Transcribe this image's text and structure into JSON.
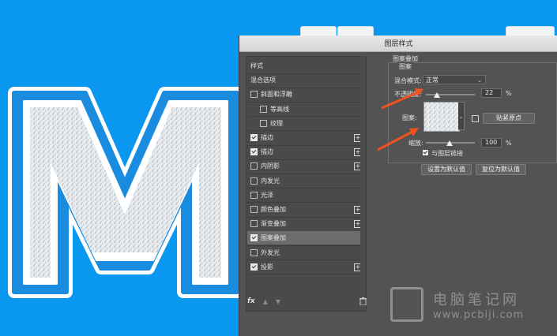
{
  "dialog": {
    "title": "图层样式",
    "styles_list": [
      {
        "label": "样式",
        "checkbox": false,
        "has_checkbox": false
      },
      {
        "label": "混合选项",
        "checkbox": false,
        "has_checkbox": false
      },
      {
        "label": "斜面和浮雕",
        "checkbox": false,
        "has_checkbox": true
      },
      {
        "label": "等高线",
        "checkbox": false,
        "has_checkbox": true,
        "indent": true
      },
      {
        "label": "纹理",
        "checkbox": false,
        "has_checkbox": true,
        "indent": true
      },
      {
        "label": "描边",
        "checkbox": true,
        "has_checkbox": true,
        "plus": true
      },
      {
        "label": "描边",
        "checkbox": true,
        "has_checkbox": true,
        "plus": true
      },
      {
        "label": "内阴影",
        "checkbox": false,
        "has_checkbox": true,
        "plus": true
      },
      {
        "label": "内发光",
        "checkbox": false,
        "has_checkbox": true
      },
      {
        "label": "光泽",
        "checkbox": false,
        "has_checkbox": true
      },
      {
        "label": "颜色叠加",
        "checkbox": false,
        "has_checkbox": true,
        "plus": true
      },
      {
        "label": "渐变叠加",
        "checkbox": false,
        "has_checkbox": true,
        "plus": true
      },
      {
        "label": "图案叠加",
        "checkbox": true,
        "has_checkbox": true,
        "selected": true
      },
      {
        "label": "外发光",
        "checkbox": false,
        "has_checkbox": true
      },
      {
        "label": "投影",
        "checkbox": true,
        "has_checkbox": true,
        "plus": true
      }
    ],
    "footer": {
      "fx_label": "fx",
      "up_icon": "arrow-up-icon",
      "down_icon": "arrow-down-icon",
      "trash_icon": "trash-icon"
    },
    "panel": {
      "section_title": "图案叠加",
      "group_title": "图案",
      "blend_mode_label": "混合模式:",
      "blend_mode_value": "正常",
      "opacity_label": "不透明度:",
      "opacity_value": "22",
      "opacity_unit": "%",
      "opacity_level": 0.22,
      "pattern_label": "图案:",
      "snap_origin_button": "贴紧原点",
      "scale_label": "缩放:",
      "scale_value": "100",
      "scale_unit": "%",
      "link_with_layer_label": "与图层链接",
      "link_with_layer_checked": true,
      "make_default_button": "设置为默认值",
      "reset_default_button": "复位为默认值"
    }
  },
  "canvas": {
    "letter": "M",
    "background_color": "#0a97ef",
    "accent_color": "#1a8ce0"
  },
  "watermark": {
    "site_name": "电脑笔记网",
    "url": "www.pcbiji.com"
  },
  "colors": {
    "dialog_bg": "#535353",
    "arrow": "#f0531d",
    "selected_row": "#6c6c6c"
  }
}
